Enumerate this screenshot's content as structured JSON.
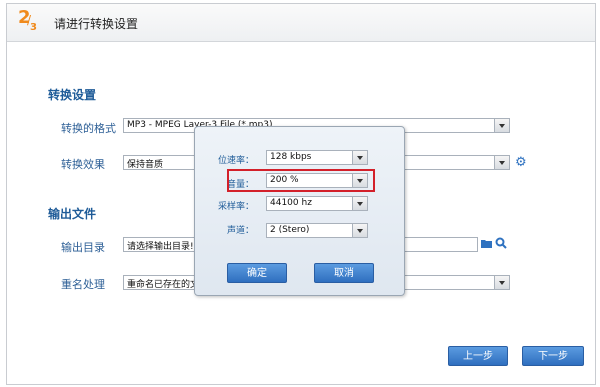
{
  "header": {
    "step_current": "2",
    "step_total": "3",
    "title": "请进行转换设置"
  },
  "convert_settings": {
    "section_title": "转换设置",
    "format_label": "转换的格式",
    "format_value": "MP3 - MPEG Layer-3 File (*.mp3)",
    "effect_label": "转换效果",
    "effect_value": "保持音质"
  },
  "output": {
    "section_title": "输出文件",
    "dir_label": "输出目录",
    "dir_value": "请选择输出目录!",
    "rename_label": "重名处理",
    "rename_value": "重命名已存在的文件"
  },
  "dialog": {
    "bitrate_label": "位速率：",
    "bitrate_value": "128 kbps",
    "volume_label": "音量：",
    "volume_value": "200 %",
    "samplerate_label": "采样率：",
    "samplerate_value": "44100 hz",
    "channel_label": "声道：",
    "channel_value": "2 (Stero)",
    "ok_label": "确定",
    "cancel_label": "取消"
  },
  "footer": {
    "prev_label": "上一步",
    "next_label": "下一步"
  },
  "colors": {
    "accent": "#f08a1c",
    "section": "#1e5b98",
    "button": "#3a7fd0",
    "highlight": "#d3202a"
  }
}
